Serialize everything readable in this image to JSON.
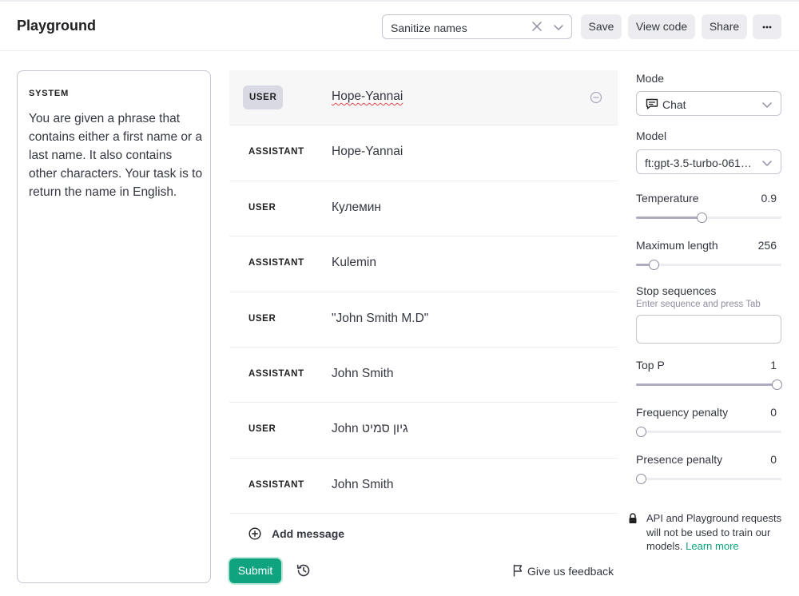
{
  "header": {
    "title": "Playground",
    "preset_value": "Sanitize names",
    "save_label": "Save",
    "view_code_label": "View code",
    "share_label": "Share"
  },
  "system": {
    "label": "SYSTEM",
    "text": "You are given a phrase that contains either a first name or a last name. It also contains other characters. Your task is to return the name in English."
  },
  "messages": [
    {
      "role": "USER",
      "content": "Hope-Yannai"
    },
    {
      "role": "ASSISTANT",
      "content": "Hope-Yannai"
    },
    {
      "role": "USER",
      "content": "Кулемин"
    },
    {
      "role": "ASSISTANT",
      "content": "Kulemin"
    },
    {
      "role": "USER",
      "content": "\"John Smith M.D\""
    },
    {
      "role": "ASSISTANT",
      "content": "John Smith"
    },
    {
      "role": "USER",
      "content": "John גיון סמיט"
    },
    {
      "role": "ASSISTANT",
      "content": "John Smith"
    }
  ],
  "add_message_label": "Add message",
  "submit_label": "Submit",
  "feedback_label": "Give us feedback",
  "settings": {
    "mode_label": "Mode",
    "mode_value": "Chat",
    "model_label": "Model",
    "model_value": "ft:gpt-3.5-turbo-0613:...",
    "temperature": {
      "label": "Temperature",
      "value": "0.9",
      "fraction": 0.45
    },
    "max_length": {
      "label": "Maximum length",
      "value": "256",
      "fraction": 0.12
    },
    "stop_label": "Stop sequences",
    "stop_hint": "Enter sequence and press Tab",
    "stop_value": "",
    "top_p": {
      "label": "Top P",
      "value": "1",
      "fraction": 1.0
    },
    "frequency": {
      "label": "Frequency penalty",
      "value": "0",
      "fraction": 0.0
    },
    "presence": {
      "label": "Presence penalty",
      "value": "0",
      "fraction": 0.0
    }
  },
  "notice": {
    "text": "API and Playground requests will not be used to train our models.",
    "link": "Learn more"
  },
  "colors": {
    "accent": "#10a37f",
    "border": "#c5c5d2",
    "button_bg": "#ececf1"
  }
}
